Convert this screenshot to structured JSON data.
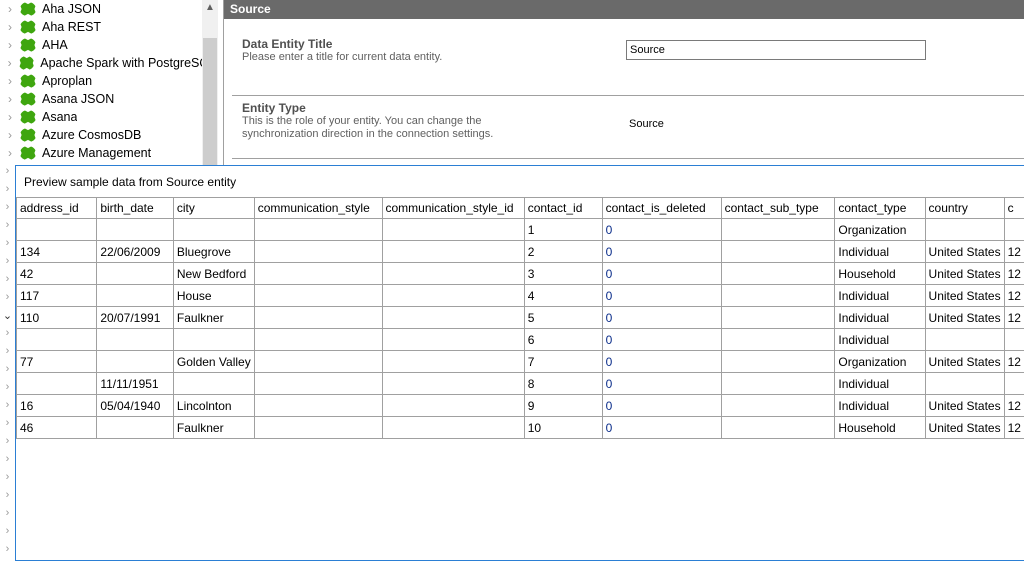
{
  "tree": {
    "items": [
      "Aha JSON",
      "Aha REST",
      "AHA",
      "Apache Spark with PostgreSQL",
      "Aproplan",
      "Asana JSON",
      "Asana",
      "Azure CosmosDB",
      "Azure Management"
    ]
  },
  "panel": {
    "header": "Source",
    "title_section": {
      "heading": "Data Entity Title",
      "description": "Please enter a title for current data entity.",
      "value": "Source"
    },
    "type_section": {
      "heading": "Entity Type",
      "description1": "This is the role of your entity. You can change the",
      "description2": "synchronization direction in the connection settings.",
      "value": "Source"
    }
  },
  "preview": {
    "title": "Preview sample data from Source entity",
    "columns": [
      "address_id",
      "birth_date",
      "city",
      "communication_style",
      "communication_style_id",
      "contact_id",
      "contact_is_deleted",
      "contact_sub_type",
      "contact_type",
      "country",
      "c"
    ],
    "rows": [
      [
        "",
        "",
        "",
        "",
        "",
        "1",
        "0",
        "",
        "Organization",
        "",
        ""
      ],
      [
        "134",
        "22/06/2009",
        "Bluegrove",
        "",
        "",
        "2",
        "0",
        "",
        "Individual",
        "United States",
        "12"
      ],
      [
        "42",
        "",
        "New Bedford",
        "",
        "",
        "3",
        "0",
        "",
        "Household",
        "United States",
        "12"
      ],
      [
        "117",
        "",
        "House",
        "",
        "",
        "4",
        "0",
        "",
        "Individual",
        "United States",
        "12"
      ],
      [
        "110",
        "20/07/1991",
        "Faulkner",
        "",
        "",
        "5",
        "0",
        "",
        "Individual",
        "United States",
        "12"
      ],
      [
        "",
        "",
        "",
        "",
        "",
        "6",
        "0",
        "",
        "Individual",
        "",
        ""
      ],
      [
        "77",
        "",
        "Golden Valley",
        "",
        "",
        "7",
        "0",
        "",
        "Organization",
        "United States",
        "12"
      ],
      [
        "",
        "11/11/1951",
        "",
        "",
        "",
        "8",
        "0",
        "",
        "Individual",
        "",
        ""
      ],
      [
        "16",
        "05/04/1940",
        "Lincolnton",
        "",
        "",
        "9",
        "0",
        "",
        "Individual",
        "United States",
        "12"
      ],
      [
        "46",
        "",
        "Faulkner",
        "",
        "",
        "10",
        "0",
        "",
        "Household",
        "United States",
        "12"
      ]
    ]
  }
}
